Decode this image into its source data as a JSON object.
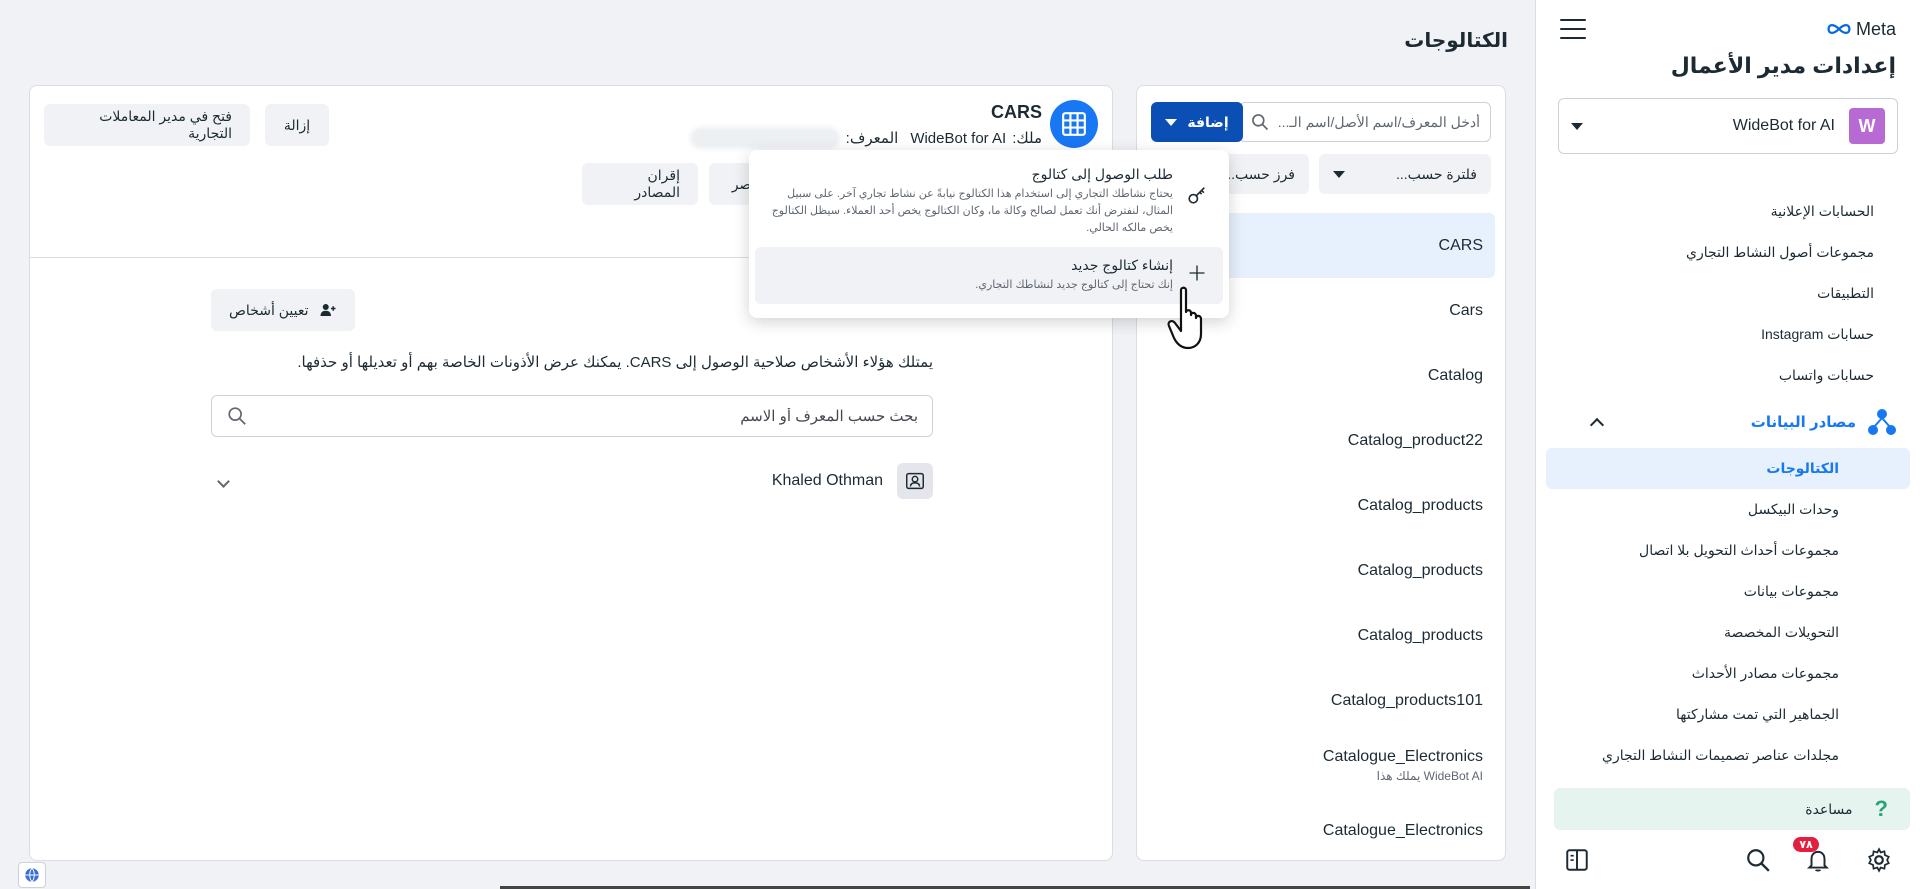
{
  "sidebar": {
    "brand": "Meta",
    "title": "إعدادات مدير الأعمال",
    "account": {
      "initial": "W",
      "name": "WideBot for AI"
    },
    "items": [
      {
        "label": "الحسابات الإعلانية"
      },
      {
        "label": "مجموعات أصول النشاط التجاري"
      },
      {
        "label": "التطبيقات"
      },
      {
        "label": "حسابات Instagram"
      },
      {
        "label": "حسابات واتساب"
      }
    ],
    "group": {
      "label": "مصادر البيانات"
    },
    "sub_items": [
      {
        "label": "الكتالوجات",
        "active": true
      },
      {
        "label": "وحدات البيكسل"
      },
      {
        "label": "مجموعات أحداث التحويل بلا اتصال"
      },
      {
        "label": "مجموعات بيانات"
      },
      {
        "label": "التحويلات المخصصة"
      },
      {
        "label": "مجموعات مصادر الأحداث"
      },
      {
        "label": "الجماهير التي تمت مشاركتها"
      },
      {
        "label": "مجلدات عناصر تصميمات النشاط التجاري"
      }
    ],
    "help_label": "مساعدة",
    "notifications_count": "٧٨"
  },
  "page": {
    "title": "الكتالوجات"
  },
  "list": {
    "search_placeholder": "أدخل المعرف/اسم الأصل/اسم الـ...",
    "add_label": "إضافة",
    "filter_label": "فلترة حسب...",
    "sort_label": "فرز حسب...",
    "catalogs": [
      {
        "name": "CARS",
        "owner": ""
      },
      {
        "name": "Cars",
        "owner": ""
      },
      {
        "name": "Catalog",
        "owner": ""
      },
      {
        "name": "Catalog_product22",
        "owner": ""
      },
      {
        "name": "Catalog_products",
        "owner": ""
      },
      {
        "name": "Catalog_products",
        "owner": ""
      },
      {
        "name": "Catalog_products",
        "owner": ""
      },
      {
        "name": "Catalog_products101",
        "owner": ""
      },
      {
        "name": "Catalogue_Electronics",
        "owner": "WideBot AI يملك هذا"
      },
      {
        "name": "Catalogue_Electronics",
        "owner": ""
      }
    ]
  },
  "detail": {
    "title": "CARS",
    "owner_prefix": "ملك:",
    "owner_name": "WideBot for AI",
    "id_label": "المعرف:",
    "open_in_commerce_label": "فتح في مدير المعاملات التجارية",
    "remove_label": "إزالة",
    "pair_sources_label": "إقران المصادر",
    "add_items_label": "إضافة عناصر",
    "assign_people_label": "تعيين أشخاص",
    "description": "يمتلك هؤلاء الأشخاص صلاحية الوصول إلى CARS. يمكنك عرض الأذونات الخاصة بهم أو تعديلها أو حذفها.",
    "people_search_placeholder": "بحث حسب المعرف أو الاسم",
    "people": [
      {
        "name": "Khaled Othman"
      }
    ]
  },
  "dropdown": {
    "items": [
      {
        "title": "طلب الوصول إلى كتالوج",
        "desc": "يحتاج نشاطك التجاري إلى استخدام هذا الكتالوج نيابةً عن نشاط تجاري آخر. على سبيل المثال، لنفترض أنك تعمل لصالح وكالة ما، وكان الكتالوج يخص أحد العملاء. سيظل الكتالوج يخص مالكه الحالي."
      },
      {
        "title": "إنشاء كتالوج جديد",
        "desc": "إنك تحتاج إلى كتالوج جديد لنشاطك التجاري."
      }
    ]
  },
  "colors": {
    "accent": "#1877f2",
    "primary_button": "#0b4fb5",
    "active_bg": "#e7f0fd",
    "avatar": "#b76bd2"
  }
}
